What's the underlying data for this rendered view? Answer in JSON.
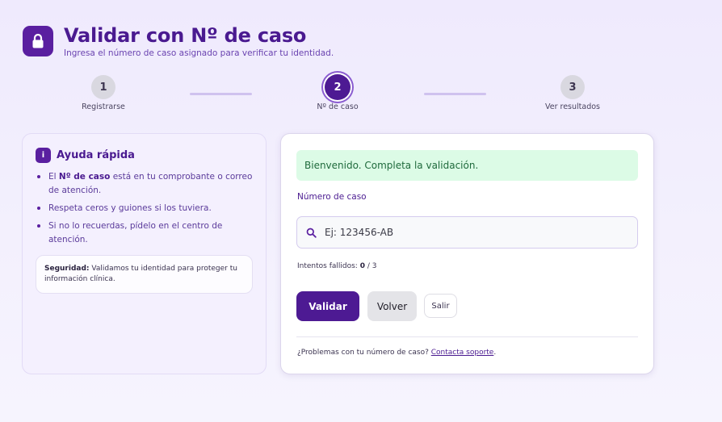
{
  "header": {
    "title": "Validar con Nº de caso",
    "subtitle": "Ingresa el número de caso asignado para verificar tu identidad.",
    "icon": "lock-icon"
  },
  "stepper": {
    "steps": [
      {
        "number": "1",
        "label": "Registrarse",
        "state": "inactive"
      },
      {
        "number": "2",
        "label": "Nº de caso",
        "state": "active"
      },
      {
        "number": "3",
        "label": "Ver resultados",
        "state": "inactive"
      }
    ]
  },
  "help": {
    "badge": "i",
    "title": "Ayuda rápida",
    "bullet1_prefix": "El",
    "bullet1_bold": "Nº de caso",
    "bullet1_suffix": "está en tu comprobante o correo de atención.",
    "bullet2": "Respeta ceros y guiones si los tuviera.",
    "bullet3": "Si no lo recuerdas, pídelo en el centro de atención.",
    "security_bold": "Seguridad:",
    "security_text": "Validamos tu identidad para proteger tu información clínica."
  },
  "form": {
    "alert": "Bienvenido. Completa la validación.",
    "field_label": "Número de caso",
    "input_value": "",
    "input_placeholder": "Ej: 123456-AB",
    "attempts_label": "Intentos fallidos:",
    "attempts_used": "0",
    "attempts_max": "/ 3",
    "validate_label": "Validar",
    "back_label": "Volver",
    "exit_label": "Salir",
    "footer_text": "¿Problemas con tu número de caso?",
    "footer_link": "Contacta soporte",
    "footer_end": "."
  },
  "colors": {
    "brand": "#4d1a93",
    "alert_bg": "#dcfbe6",
    "alert_text": "#1f6a3c",
    "background": "#efeafd"
  }
}
